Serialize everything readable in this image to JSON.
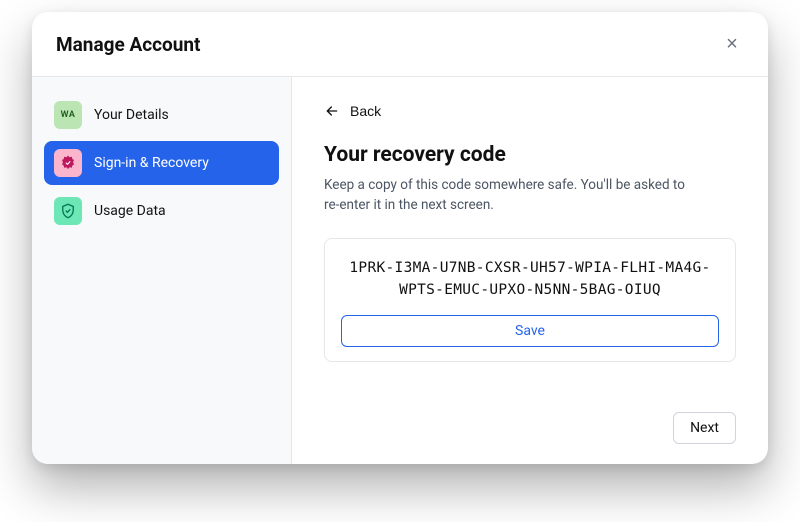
{
  "modal": {
    "title": "Manage Account",
    "close_symbol": "×"
  },
  "sidebar": {
    "items": [
      {
        "label": "Your Details",
        "avatar_text": "WA"
      },
      {
        "label": "Sign-in & Recovery"
      },
      {
        "label": "Usage Data"
      }
    ]
  },
  "main": {
    "back_label": "Back",
    "heading": "Your recovery code",
    "description": "Keep a copy of this code somewhere safe. You'll be asked to re-enter it in the next screen.",
    "recovery_code": "1PRK-I3MA-U7NB-CXSR-UH57-WPIA-FLHI-MA4G-WPTS-EMUC-UPXO-N5NN-5BAG-OIUQ",
    "save_label": "Save",
    "next_label": "Next"
  }
}
